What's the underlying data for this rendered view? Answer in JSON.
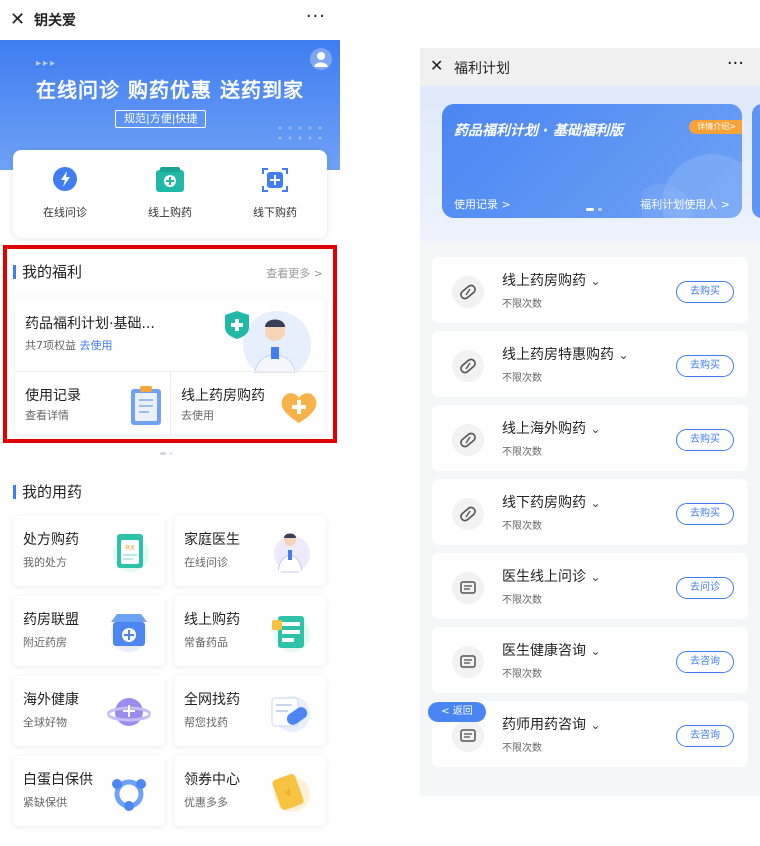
{
  "left": {
    "header": {
      "title": "钥关爱",
      "close_icon": "close-icon",
      "more_icon": "more-icon"
    },
    "hero": {
      "title": "在线问诊 购药优惠 送药到家",
      "tagline": "规范|方便|快捷"
    },
    "quick_actions": [
      {
        "label": "在线问诊",
        "icon": "chat-bolt-icon"
      },
      {
        "label": "线上购药",
        "icon": "medicine-box-icon"
      },
      {
        "label": "线下购药",
        "icon": "scan-plus-icon"
      }
    ],
    "welfare": {
      "title": "我的福利",
      "see_more": "查看更多 >",
      "plan_name": "药品福利计划·基础...",
      "benefits_prefix": "共7项权益",
      "use_link": "去使用",
      "records_title": "使用记录",
      "records_sub": "查看详情",
      "online_title": "线上药房购药",
      "online_sub": "去使用"
    },
    "medication": {
      "title": "我的用药",
      "items": [
        {
          "title": "处方购药",
          "sub": "我的处方",
          "icon": "prescription-icon"
        },
        {
          "title": "家庭医生",
          "sub": "在线问诊",
          "icon": "doctor-icon"
        },
        {
          "title": "药房联盟",
          "sub": "附近药房",
          "icon": "pharmacy-icon"
        },
        {
          "title": "线上购药",
          "sub": "常备药品",
          "icon": "medicine-list-icon"
        },
        {
          "title": "海外健康",
          "sub": "全球好物",
          "icon": "planet-icon"
        },
        {
          "title": "全网找药",
          "sub": "帮您找药",
          "icon": "pill-icon"
        },
        {
          "title": "白蛋白保供",
          "sub": "紧缺保供",
          "icon": "network-icon"
        },
        {
          "title": "领券中心",
          "sub": "优惠多多",
          "icon": "coupon-icon"
        }
      ]
    },
    "colors": {
      "accent": "#3f7df0",
      "highlight_border": "#e00000"
    }
  },
  "right": {
    "header": {
      "title": "福利计划",
      "close_icon": "close-icon",
      "more_icon": "more-icon"
    },
    "banner": {
      "title": "药品福利计划 · 基础福利版",
      "tag": "详情介绍>",
      "left_link": "使用记录 >",
      "right_link": "福利计划使用人 >"
    },
    "back_label": "< 返回",
    "items": [
      {
        "title": "线上药房购药",
        "sub": "不限次数",
        "button": "去购买",
        "icon": "pill-capsule-icon"
      },
      {
        "title": "线上药房特惠购药",
        "sub": "不限次数",
        "button": "去购买",
        "icon": "pill-capsule-icon"
      },
      {
        "title": "线上海外购药",
        "sub": "不限次数",
        "button": "去购买",
        "icon": "pill-capsule-icon"
      },
      {
        "title": "线下药房购药",
        "sub": "不限次数",
        "button": "去购买",
        "icon": "pill-capsule-icon"
      },
      {
        "title": "医生线上问诊",
        "sub": "不限次数",
        "button": "去问诊",
        "icon": "chat-bubble-icon"
      },
      {
        "title": "医生健康咨询",
        "sub": "不限次数",
        "button": "去咨询",
        "icon": "chat-bubble-icon"
      },
      {
        "title": "药师用药咨询",
        "sub": "不限次数",
        "button": "去咨询",
        "icon": "chat-bubble-icon"
      }
    ]
  }
}
